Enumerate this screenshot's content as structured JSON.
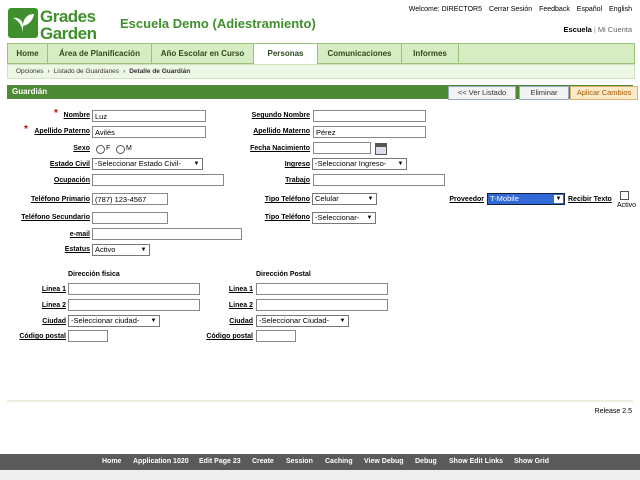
{
  "logo": {
    "line1": "Grades",
    "line2": "Garden"
  },
  "app_title": "Escuela Demo (Adiestramiento)",
  "top_links": {
    "welcome": "Welcome: DIRECTOR5",
    "logout": "Cerrar Sesión",
    "feedback": "Feedback",
    "spanish": "Español",
    "english": "English"
  },
  "school_links": {
    "school": "Escuela",
    "account": "Mi Cuenta"
  },
  "tabs": [
    "Home",
    "Área de Planificación",
    "Año Escolar en Curso",
    "Personas",
    "Comunicaciones",
    "Informes"
  ],
  "active_tab": "Personas",
  "breadcrumb": [
    "Opciones",
    "Listado de Guardianes",
    "Detalle de Guardián"
  ],
  "region": {
    "title": "Guardián",
    "btn_list": "<< Ver Listado",
    "btn_delete": "Eliminar",
    "btn_apply": "Aplicar Cambios"
  },
  "form": {
    "nombre": {
      "label": "Nombre",
      "value": "Luz"
    },
    "segundo_nombre": {
      "label": "Segundo Nombre",
      "value": ""
    },
    "apellido_paterno": {
      "label": "Apellido Paterno",
      "value": "Avilés"
    },
    "apellido_materno": {
      "label": "Apellido Materno",
      "value": "Pérez"
    },
    "sexo": {
      "label": "Sexo",
      "opt_f": "F",
      "opt_m": "M"
    },
    "fecha_nacimiento": {
      "label": "Fecha Nacimiento",
      "value": ""
    },
    "estado_civil": {
      "label": "Estado Civil",
      "value": "-Seleccionar Estado Civil-"
    },
    "ingreso": {
      "label": "Ingreso",
      "value": "-Seleccionar Ingreso-"
    },
    "ocupacion": {
      "label": "Ocupación",
      "value": ""
    },
    "trabajo": {
      "label": "Trabajo",
      "value": ""
    },
    "telefono_primario": {
      "label": "Teléfono Primario",
      "value": "(787) 123-4567"
    },
    "tipo_telefono_1": {
      "label": "Tipo Teléfono",
      "value": "Celular"
    },
    "proveedor": {
      "label": "Proveedor",
      "value": "T-Mobile"
    },
    "recibir_texto": {
      "label": "Recibir Texto",
      "status": "Activo"
    },
    "telefono_secundario": {
      "label": "Teléfono Secundario",
      "value": ""
    },
    "tipo_telefono_2": {
      "label": "Tipo Teléfono",
      "value": "-Seleccionar-"
    },
    "email": {
      "label": "e-mail",
      "value": ""
    },
    "estatus": {
      "label": "Estatus",
      "value": "Activo"
    }
  },
  "address": {
    "physical_title": "Dirección física",
    "postal_title": "Dirección Postal",
    "linea1": "Linea 1",
    "linea2": "Linea 2",
    "ciudad": "Ciudad",
    "codigo_postal": "Código postal",
    "city_physical": "-Seleccionar ciudad-",
    "city_postal": "-Seleccionar Ciudad-"
  },
  "release": "Release 2.5",
  "devbar": [
    "Home",
    "Application 1020",
    "Edit Page 23",
    "Create",
    "Session",
    "Caching",
    "View Debug",
    "Debug",
    "Show Edit Links",
    "Show Grid"
  ]
}
